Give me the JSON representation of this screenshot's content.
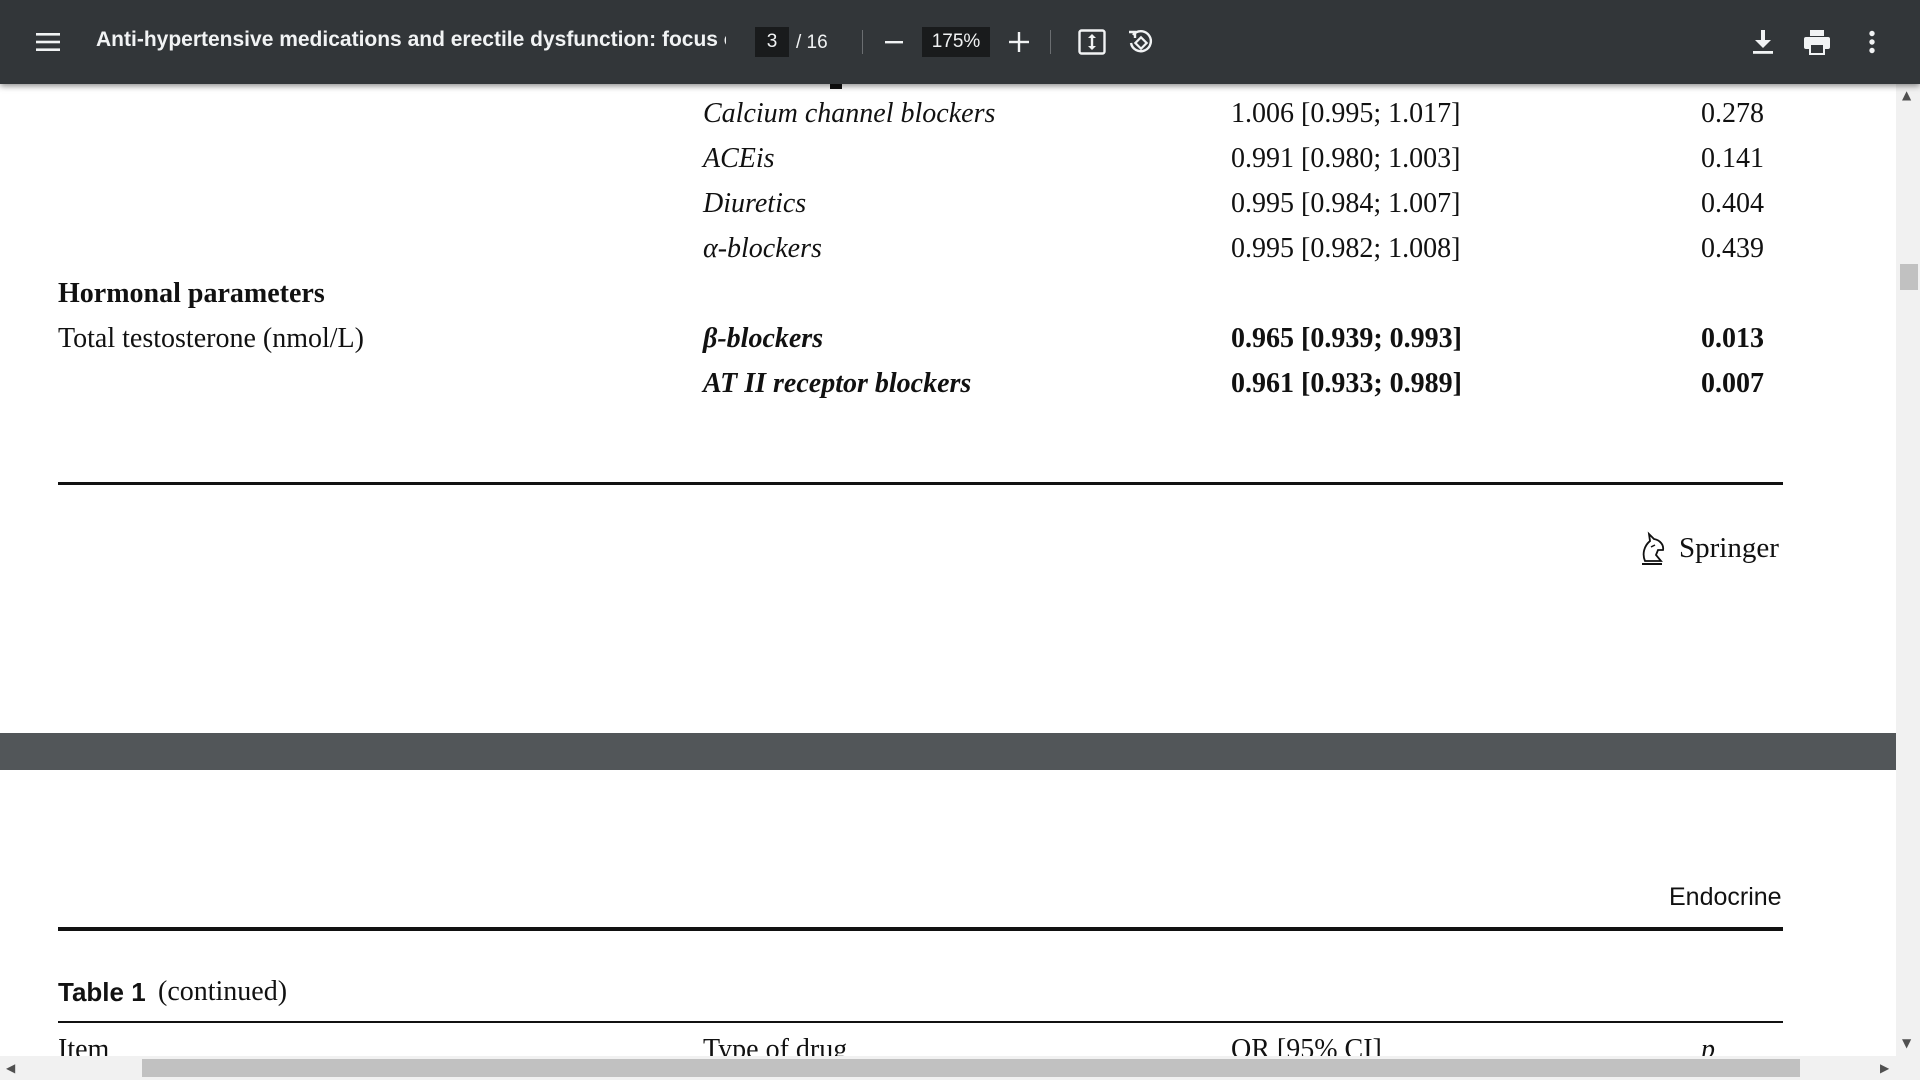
{
  "toolbar": {
    "menu_icon": "hamburger-menu-icon",
    "title": "Anti-hypertensive medications and erectile dysfunction: focus o...",
    "current_page": "3",
    "total_pages": "/ 16",
    "zoom": "175%",
    "icons": [
      "minus-icon",
      "plus-icon",
      "fit-page-icon",
      "rotate-icon",
      "download-icon",
      "print-icon",
      "more-vert-icon"
    ],
    "colors": {
      "toolbar_bg": "#323639",
      "text": "#f1f3f4",
      "input_bg": "#191b1c",
      "page_gap": "#525659"
    }
  },
  "page3": {
    "rows": [
      {
        "drug": "Calcium channel blockers",
        "or_ci": "1.006 [0.995; 1.017]",
        "p": "0.278"
      },
      {
        "drug": "ACEis",
        "or_ci": "0.991 [0.980; 1.003]",
        "p": "0.141"
      },
      {
        "drug": "Diuretics",
        "or_ci": "0.995 [0.984; 1.007]",
        "p": "0.404"
      },
      {
        "drug": "α-blockers",
        "or_ci": "0.995 [0.982; 1.008]",
        "p": "0.439"
      }
    ],
    "section_heading": "Hormonal parameters",
    "item_label": "Total testosterone (nmol/L)",
    "bold_rows": [
      {
        "drug": "β-blockers",
        "or_ci": "0.965 [0.939; 0.993]",
        "p": "0.013"
      },
      {
        "drug": "AT II receptor blockers",
        "or_ci": "0.961 [0.933; 0.989]",
        "p": "0.007"
      }
    ],
    "publisher": "Springer",
    "publisher_icon": "springer-horse-logo-icon"
  },
  "page4": {
    "journal": "Endocrine",
    "table_label": "Table 1",
    "table_continued": "(continued)",
    "headers": [
      "Item",
      "Type of drug",
      "OR [95% CI]",
      "p"
    ]
  }
}
